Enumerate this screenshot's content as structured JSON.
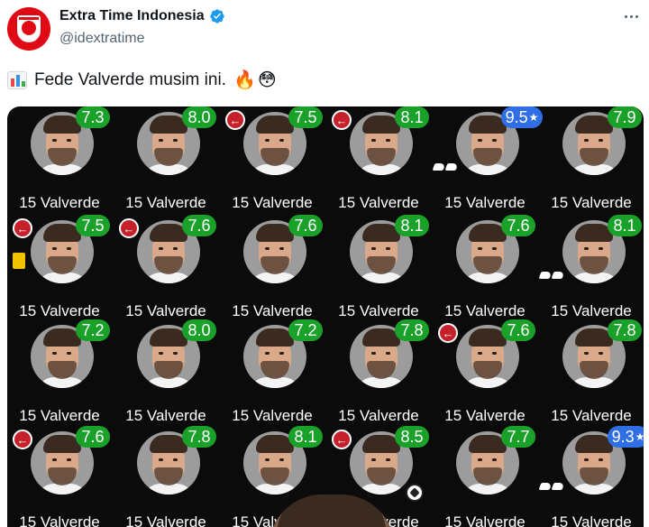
{
  "account": {
    "display_name": "Extra Time Indonesia",
    "handle": "@idextratime"
  },
  "tweet": {
    "text": "Fede Valverde musim ini.",
    "emojis": [
      "🔥",
      "😳"
    ]
  },
  "icons": {
    "avatar": "extra-time-logo",
    "verified": "verified-badge-icon",
    "more": "more-options-icon",
    "chart": "bar-chart-emoji",
    "sub": "substitution-icon",
    "card": "yellow-card-icon",
    "boot": "assist-boots-icon",
    "ball": "goal-ball-icon"
  },
  "colors": {
    "rating_green": "#1aa12a",
    "rating_blue": "#2f6ee5",
    "verified": "#1d9bf0",
    "sub_red": "#c6202a",
    "media_bg": "#0b0b0b"
  },
  "player_label": "15 Valverde",
  "ratings": [
    {
      "value": "7.3"
    },
    {
      "value": "8.0"
    },
    {
      "value": "7.5",
      "sub": true
    },
    {
      "value": "8.1",
      "sub": true
    },
    {
      "value": "9.5",
      "blue": true,
      "boot": true
    },
    {
      "value": "7.9"
    },
    {
      "value": "7.5",
      "sub": true,
      "card": true
    },
    {
      "value": "7.6",
      "sub": true
    },
    {
      "value": "7.6"
    },
    {
      "value": "8.1"
    },
    {
      "value": "7.6"
    },
    {
      "value": "8.1",
      "boot": true
    },
    {
      "value": "7.2"
    },
    {
      "value": "8.0"
    },
    {
      "value": "7.2"
    },
    {
      "value": "7.8"
    },
    {
      "value": "7.6",
      "sub": true
    },
    {
      "value": "7.8"
    },
    {
      "value": "7.6",
      "sub": true
    },
    {
      "value": "7.8"
    },
    {
      "value": "8.1"
    },
    {
      "value": "8.5",
      "sub": true,
      "ball": true
    },
    {
      "value": "7.7"
    },
    {
      "value": "9.3",
      "blue": true,
      "boot": true
    }
  ]
}
